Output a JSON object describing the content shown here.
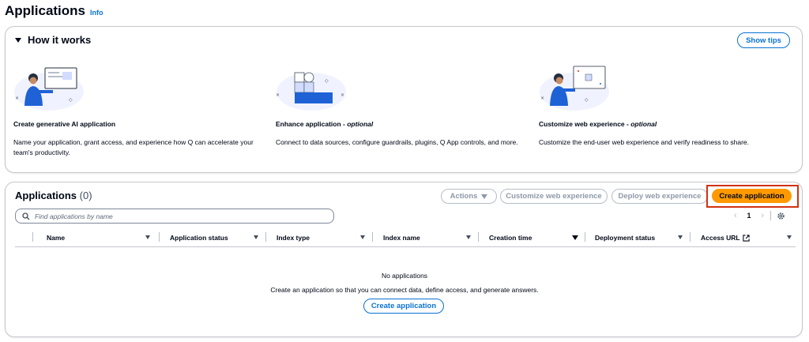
{
  "header": {
    "title": "Applications",
    "info": "Info"
  },
  "how_it_works": {
    "title": "How it works",
    "show_tips": "Show tips",
    "steps": [
      {
        "title": "Create generative AI application",
        "optional": "",
        "description": "Name your application, grant access, and experience how Q can accelerate your team's productivity."
      },
      {
        "title": "Enhance application - ",
        "optional": "optional",
        "description": "Connect to data sources, configure guardrails, plugins, Q App controls, and more."
      },
      {
        "title": "Customize web experience - ",
        "optional": "optional",
        "description": "Customize the end-user web experience and verify readiness to share."
      }
    ]
  },
  "applications": {
    "title": "Applications",
    "count": "(0)",
    "actions": "Actions",
    "customize": "Customize web experience",
    "deploy": "Deploy web experience",
    "create": "Create application",
    "search_placeholder": "Find applications by name",
    "page": "1",
    "columns": [
      "Name",
      "Application status",
      "Index type",
      "Index name",
      "Creation time",
      "Deployment status",
      "Access URL"
    ],
    "empty_title": "No applications",
    "empty_desc": "Create an application so that you can connect data, define access, and generate answers.",
    "empty_button": "Create application"
  },
  "colors": {
    "primary": "#ff9900",
    "link": "#0972d3",
    "highlight": "#d13212"
  }
}
